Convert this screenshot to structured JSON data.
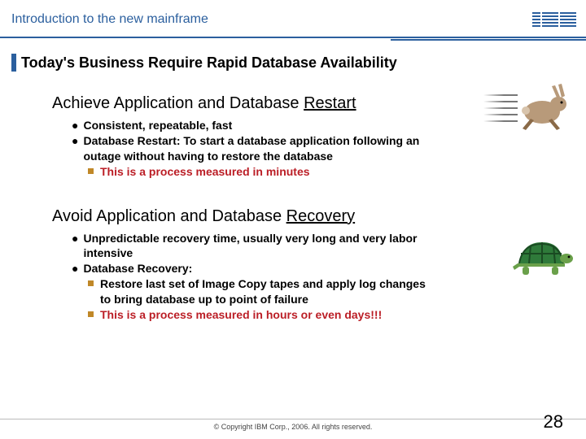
{
  "header": {
    "title": "Introduction to the new mainframe",
    "logo_text": "IBM"
  },
  "slide": {
    "title": "Today's Business Require Rapid Database Availability"
  },
  "section1": {
    "heading_pre": "Achieve Application and Database ",
    "heading_underlined": "Restart",
    "bullets": [
      "Consistent, repeatable, fast",
      "Database Restart:  To start a database application following an outage without having to restore the database"
    ],
    "sub": "This is a process measured in minutes"
  },
  "section2": {
    "heading_pre": "Avoid Application and Database ",
    "heading_underlined": "Recovery",
    "bullets": [
      "Unpredictable recovery time, usually very long and very labor intensive",
      "Database Recovery:"
    ],
    "subs": [
      "Restore last set of Image Copy tapes and apply log changes to bring database up to point of failure",
      "This is a process measured in hours or even days!!!"
    ]
  },
  "footer": {
    "copyright": "© Copyright IBM Corp., 2006. All rights reserved.",
    "page": "28"
  },
  "illustrations": {
    "rabbit": "rabbit-running",
    "tortoise": "tortoise-walking"
  }
}
